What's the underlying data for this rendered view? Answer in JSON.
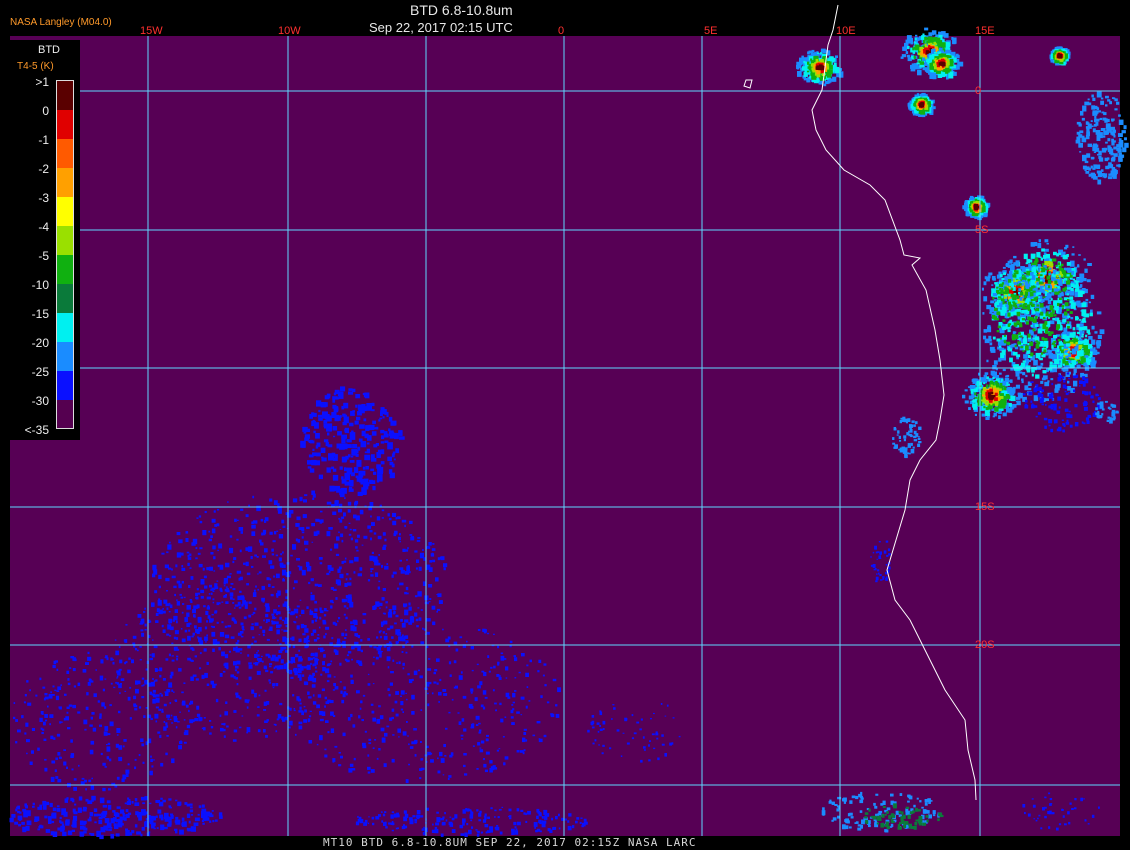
{
  "header": {
    "credit": "NASA Langley (M04.0)",
    "title": "BTD 6.8-10.8um",
    "subtitle": "Sep 22, 2017 02:15 UTC"
  },
  "footer": {
    "text": "MT10  BTD 6.8-10.8UM  SEP 22, 2017 02:15Z  NASA LARC"
  },
  "legend": {
    "title": "BTD",
    "units": "T4-5 (K)",
    "levels": [
      {
        "label": ">1",
        "color": "#5a0000"
      },
      {
        "label": "0",
        "color": "#e00000"
      },
      {
        "label": "-1",
        "color": "#ff5a00"
      },
      {
        "label": "-2",
        "color": "#ffa000"
      },
      {
        "label": "-3",
        "color": "#ffff00"
      },
      {
        "label": "-4",
        "color": "#9ae000"
      },
      {
        "label": "-5",
        "color": "#10b010"
      },
      {
        "label": "-10",
        "color": "#0a7a3a"
      },
      {
        "label": "-15",
        "color": "#00f0f0"
      },
      {
        "label": "-20",
        "color": "#1a8cff"
      },
      {
        "label": "-25",
        "color": "#0a10ff"
      },
      {
        "label": "-30",
        "color": "#550050"
      },
      {
        "label": "<-35",
        "color": "#550050"
      }
    ]
  },
  "map": {
    "background": "#570055",
    "grid_color": "#5fd8ff",
    "lon_labels": [
      "15W",
      "10W",
      "0",
      "5E",
      "10E",
      "15E"
    ],
    "lat_labels": [
      "0",
      "5S",
      "15S",
      "20S"
    ],
    "label_color": "#ff3030"
  }
}
